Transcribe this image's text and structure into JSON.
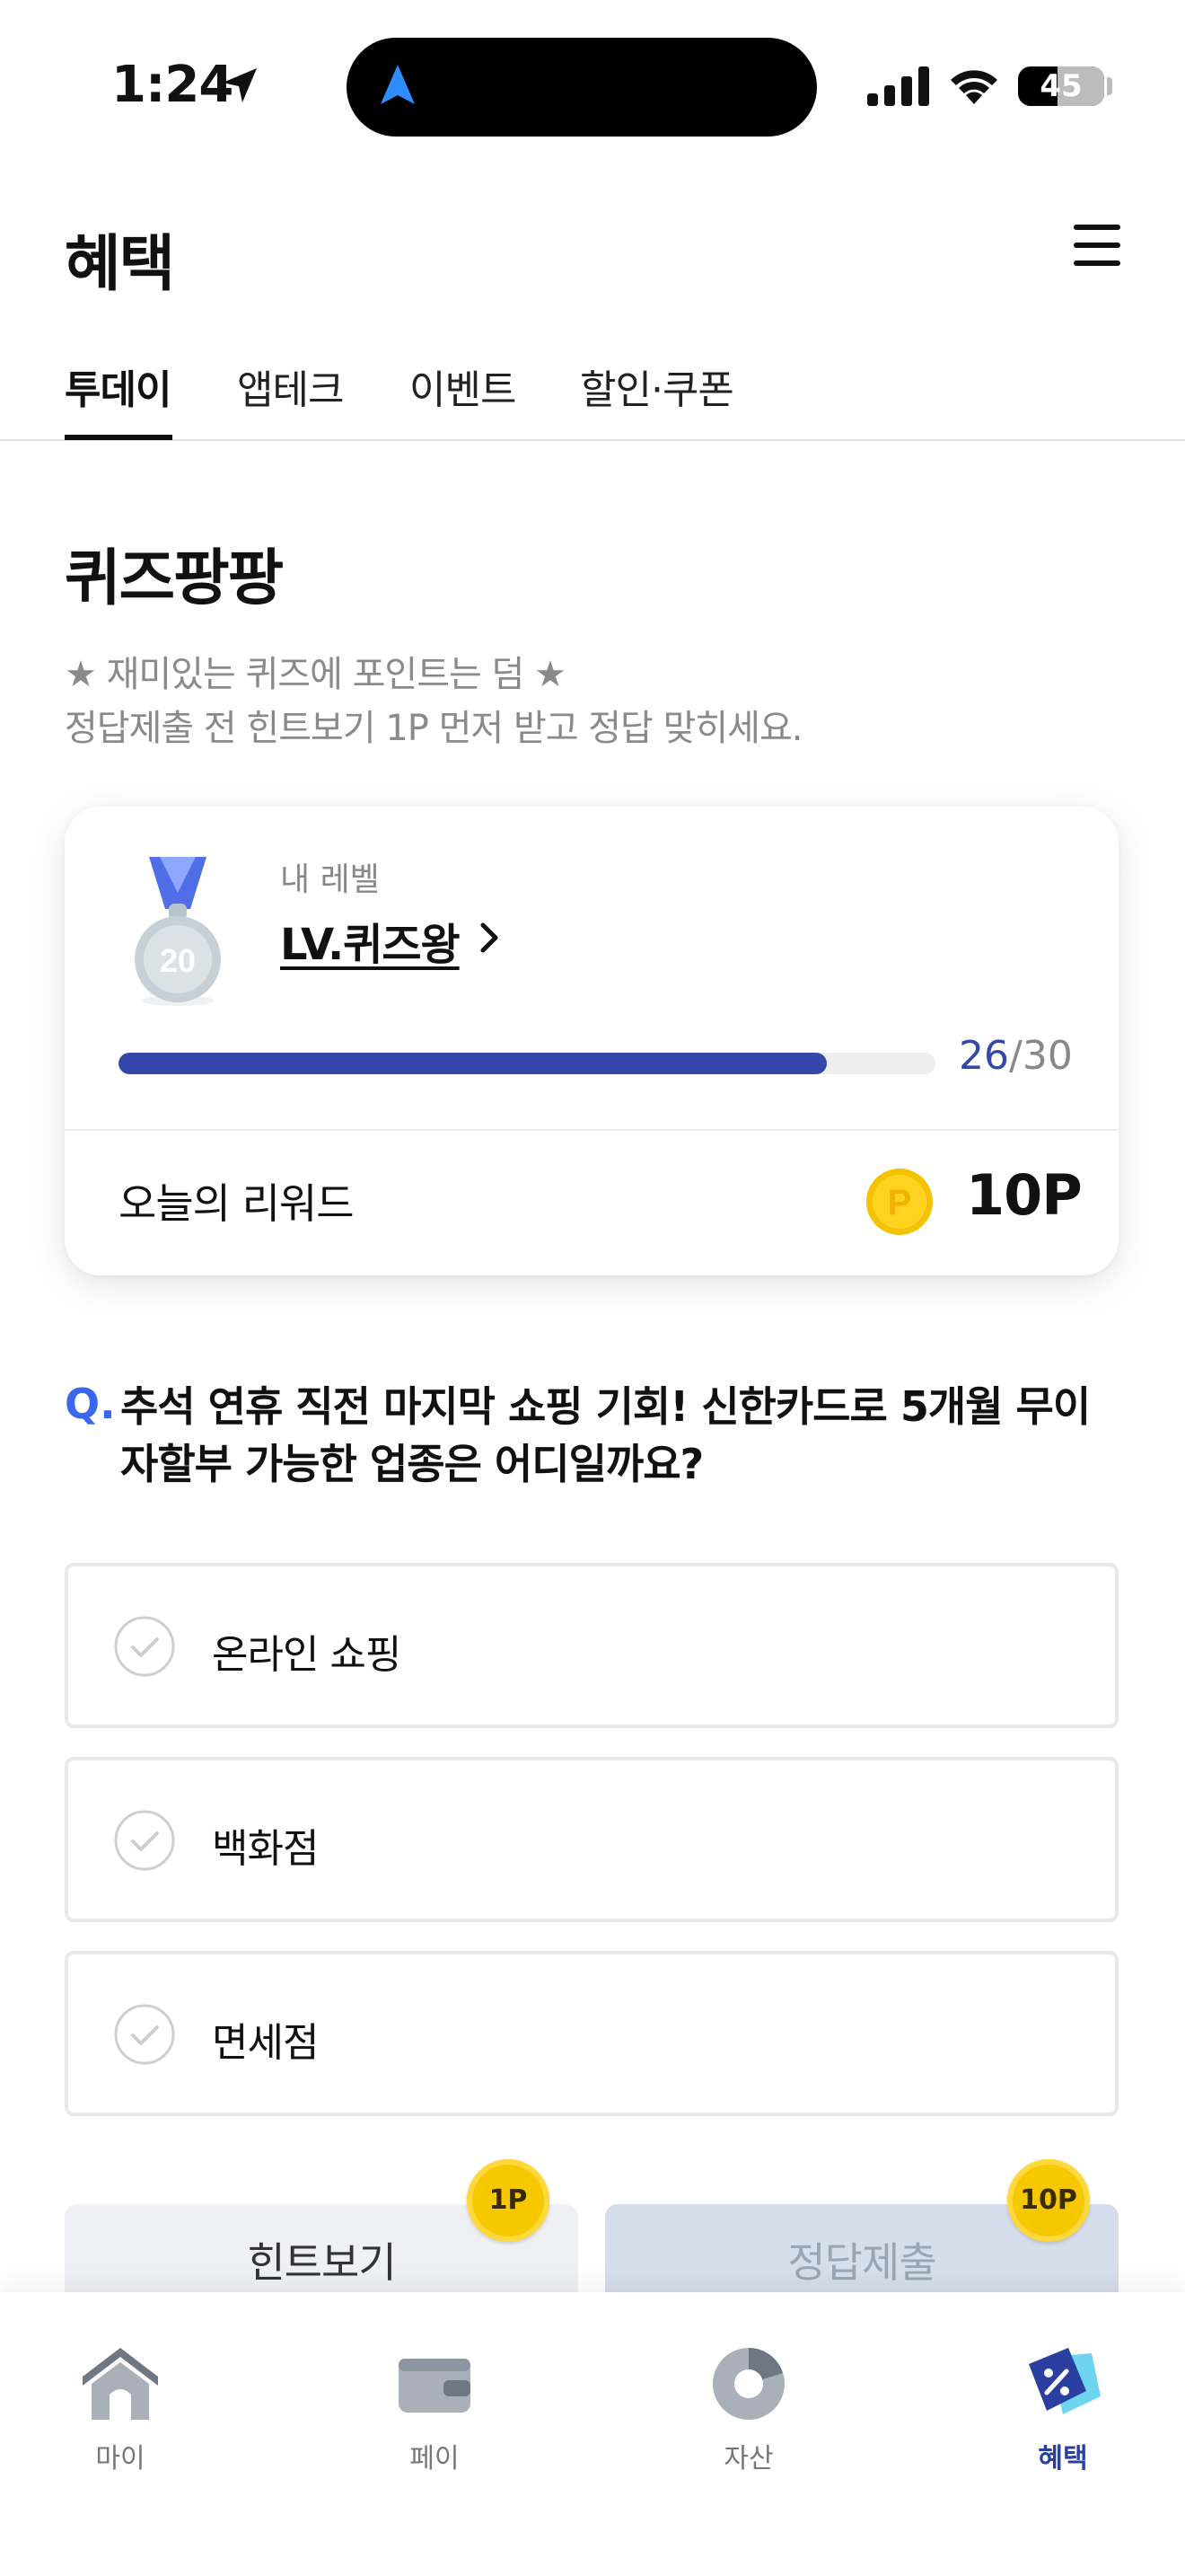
{
  "status_bar": {
    "time": "1:24",
    "battery": "45"
  },
  "header": {
    "title": "혜택"
  },
  "tabs": [
    {
      "label": "투데이",
      "active": true
    },
    {
      "label": "앱테크",
      "active": false
    },
    {
      "label": "이벤트",
      "active": false
    },
    {
      "label": "할인·쿠폰",
      "active": false
    }
  ],
  "quiz": {
    "title": "퀴즈팡팡",
    "description_line1": "★ 재미있는 퀴즈에 포인트는 덤 ★",
    "description_line2": "정답제출 전 힌트보기 1P 먼저 받고 정답 맞히세요.",
    "level_card": {
      "label": "내 레벨",
      "level_name": "LV.퀴즈왕",
      "medal_number": "20",
      "progress_current": "26",
      "progress_total": "/30",
      "progress_fraction": 0.8667,
      "reward_label": "오늘의 리워드",
      "reward_value": "10P"
    },
    "question_mark": "Q.",
    "question": "추석 연휴 직전 마지막 쇼핑 기회! 신한카드로 5개월 무이자할부 가능한 업종은 어디일까요?",
    "options": [
      "온라인 쇼핑",
      "백화점",
      "면세점"
    ],
    "hint_button": "힌트보기",
    "hint_badge": "1P",
    "submit_button": "정답제출",
    "submit_badge": "10P"
  },
  "bottom_nav": [
    {
      "label": "마이",
      "icon": "home-icon",
      "active": false
    },
    {
      "label": "페이",
      "icon": "wallet-icon",
      "active": false
    },
    {
      "label": "자산",
      "icon": "pie-chart-icon",
      "active": false
    },
    {
      "label": "혜택",
      "icon": "benefit-tag-icon",
      "active": true
    }
  ],
  "colors": {
    "accent": "#3348a8",
    "question_mark": "#3a66f0",
    "coin": "#f6c800",
    "active_nav": "#2a3fa0"
  }
}
